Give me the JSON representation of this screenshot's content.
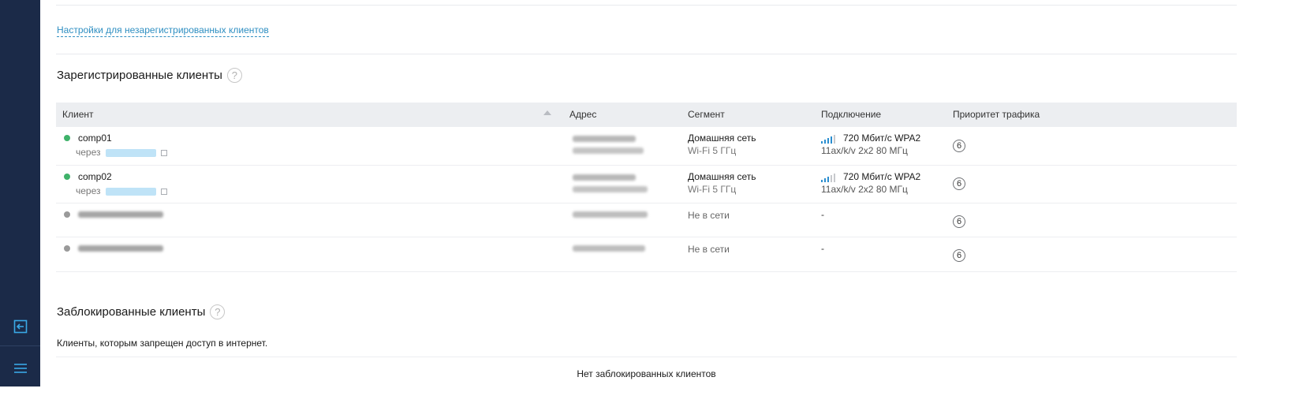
{
  "sidebar": {
    "icons": [
      "logout-icon",
      "menu-icon"
    ],
    "accent": "#3aa8e6",
    "background": "#1b2a48"
  },
  "unregistered_link": "Настройки для незарегистрированных клиентов",
  "registered": {
    "title": "Зарегистрированные клиенты",
    "help": "?",
    "columns": [
      "Клиент",
      "Адрес",
      "Сегмент",
      "Подключение",
      "Приоритет трафика"
    ],
    "rows": [
      {
        "name": "comp01",
        "status": "online",
        "via": "через",
        "segment": "Домашняя сеть",
        "band": "Wi-Fi 5 ГГц",
        "speed": "720 Мбит/с WPA2",
        "mode": "11ax/k/v 2x2 80 МГц",
        "priority": "6"
      },
      {
        "name": "comp02",
        "status": "online",
        "via": "через",
        "segment": "Домашняя сеть",
        "band": "Wi-Fi 5 ГГц",
        "speed": "720 Мбит/с WPA2",
        "mode": "11ax/k/v 2x2 80 МГц",
        "priority": "6"
      },
      {
        "name": "",
        "status": "offline",
        "segment": "Не в сети",
        "connection": "-",
        "priority": "6"
      },
      {
        "name": "",
        "status": "offline",
        "segment": "Не в сети",
        "connection": "-",
        "priority": "6"
      }
    ]
  },
  "blocked": {
    "title": "Заблокированные клиенты",
    "help": "?",
    "description": "Клиенты, которым запрещен доступ в интернет.",
    "empty": "Нет заблокированных клиентов"
  },
  "colors": {
    "online": "#3fb26a",
    "offline": "#9a9a9a",
    "link": "#2f8fc2",
    "signal": "#2a8ed0"
  }
}
